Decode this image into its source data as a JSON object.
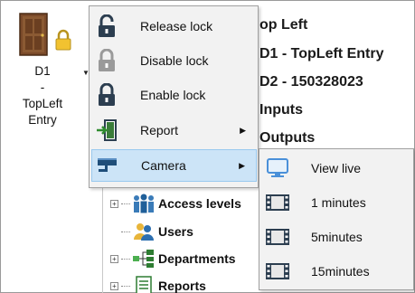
{
  "door_button": {
    "label_lines": [
      "D1",
      "-",
      "TopLeft",
      "Entry"
    ],
    "icon": "door-with-lock-icon"
  },
  "info_panel": {
    "lines": [
      "op Left",
      "D1 - TopLeft Entry",
      "D2 - 150328023",
      "Inputs",
      "Outputs"
    ]
  },
  "context_menu": {
    "items": [
      {
        "label": "Release lock",
        "icon": "unlocked-padlock-icon",
        "submenu": false
      },
      {
        "label": "Disable lock",
        "icon": "disabled-padlock-icon",
        "submenu": false
      },
      {
        "label": "Enable lock",
        "icon": "locked-padlock-icon",
        "submenu": false
      },
      {
        "label": "Report",
        "icon": "door-exit-report-icon",
        "submenu": true
      },
      {
        "label": "Camera",
        "icon": "security-camera-icon",
        "submenu": true,
        "highlighted": true
      }
    ]
  },
  "camera_submenu": {
    "items": [
      {
        "label": "View live",
        "icon": "monitor-icon"
      },
      {
        "label": "1 minutes",
        "icon": "film-strip-icon"
      },
      {
        "label": "5minutes",
        "icon": "film-strip-icon"
      },
      {
        "label": "15minutes",
        "icon": "film-strip-icon"
      }
    ]
  },
  "tree": {
    "items": [
      {
        "label": "Access levels",
        "icon": "people-group-icon",
        "expandable": true
      },
      {
        "label": "Users",
        "icon": "users-icon",
        "expandable": false
      },
      {
        "label": "Departments",
        "icon": "org-chart-icon",
        "expandable": true
      },
      {
        "label": "Reports",
        "icon": "report-document-icon",
        "expandable": true
      }
    ]
  },
  "colors": {
    "menu_background": "#f2f2f2",
    "highlight_fill": "#cce4f7",
    "highlight_border": "#99c9ef",
    "padlock": "#2c3e50",
    "camera_icon": "#1f4e79"
  }
}
